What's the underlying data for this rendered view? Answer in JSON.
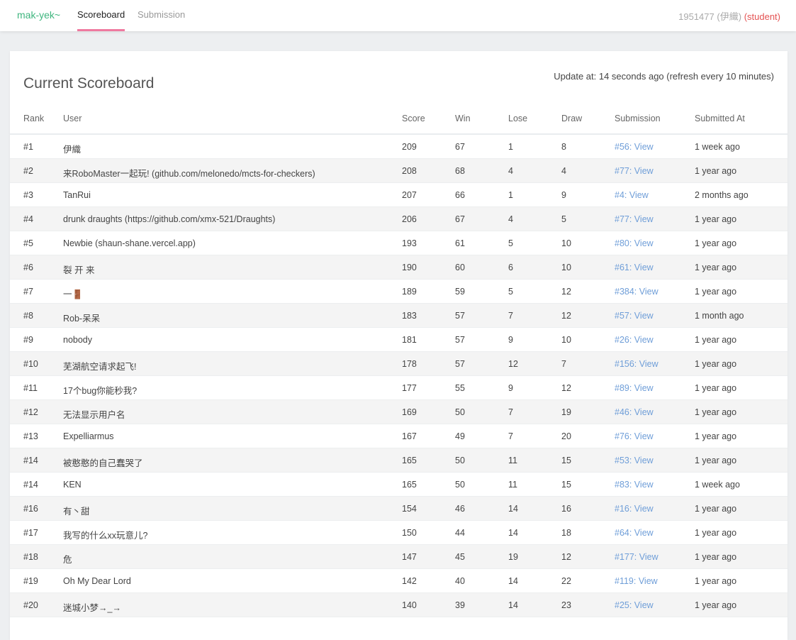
{
  "nav": {
    "brand": "mak-yek~",
    "tabs": [
      {
        "label": "Scoreboard",
        "active": true
      },
      {
        "label": "Submission",
        "active": false
      }
    ],
    "user_id": "1951477",
    "user_name": "(伊織)",
    "user_role": "(student)"
  },
  "scoreboard": {
    "title": "Current Scoreboard",
    "update_text": "Update at: 14 seconds ago (refresh every 10 minutes)",
    "columns": [
      "Rank",
      "User",
      "Score",
      "Win",
      "Lose",
      "Draw",
      "Submission",
      "Submitted At"
    ],
    "rows": [
      {
        "rank": "#1",
        "user": "伊織",
        "score": "209",
        "win": "67",
        "lose": "1",
        "draw": "8",
        "submission": "#56: View",
        "submitted_at": "1 week ago"
      },
      {
        "rank": "#2",
        "user": "来RoboMaster一起玩! (github.com/melonedo/mcts-for-checkers)",
        "score": "208",
        "win": "68",
        "lose": "4",
        "draw": "4",
        "submission": "#77: View",
        "submitted_at": "1 year ago"
      },
      {
        "rank": "#3",
        "user": "TanRui",
        "score": "207",
        "win": "66",
        "lose": "1",
        "draw": "9",
        "submission": "#4: View",
        "submitted_at": "2 months ago"
      },
      {
        "rank": "#4",
        "user": "drunk draughts (https://github.com/xmx-521/Draughts)",
        "score": "206",
        "win": "67",
        "lose": "4",
        "draw": "5",
        "submission": "#77: View",
        "submitted_at": "1 year ago"
      },
      {
        "rank": "#5",
        "user": "Newbie (shaun-shane.vercel.app)",
        "score": "193",
        "win": "61",
        "lose": "5",
        "draw": "10",
        "submission": "#80: View",
        "submitted_at": "1 year ago"
      },
      {
        "rank": "#6",
        "user": "裂 开 来",
        "score": "190",
        "win": "60",
        "lose": "6",
        "draw": "10",
        "submission": "#61: View",
        "submitted_at": "1 year ago"
      },
      {
        "rank": "#7",
        "user": "一🚪",
        "score": "189",
        "win": "59",
        "lose": "5",
        "draw": "12",
        "submission": "#384: View",
        "submitted_at": "1 year ago"
      },
      {
        "rank": "#8",
        "user": "Rob-呆呆",
        "score": "183",
        "win": "57",
        "lose": "7",
        "draw": "12",
        "submission": "#57: View",
        "submitted_at": "1 month ago"
      },
      {
        "rank": "#9",
        "user": "nobody",
        "score": "181",
        "win": "57",
        "lose": "9",
        "draw": "10",
        "submission": "#26: View",
        "submitted_at": "1 year ago"
      },
      {
        "rank": "#10",
        "user": "芜湖航空请求起飞!",
        "score": "178",
        "win": "57",
        "lose": "12",
        "draw": "7",
        "submission": "#156: View",
        "submitted_at": "1 year ago"
      },
      {
        "rank": "#11",
        "user": "17个bug你能秒我?",
        "score": "177",
        "win": "55",
        "lose": "9",
        "draw": "12",
        "submission": "#89: View",
        "submitted_at": "1 year ago"
      },
      {
        "rank": "#12",
        "user": "无法显示用户名",
        "score": "169",
        "win": "50",
        "lose": "7",
        "draw": "19",
        "submission": "#46: View",
        "submitted_at": "1 year ago"
      },
      {
        "rank": "#13",
        "user": "Expelliarmus",
        "score": "167",
        "win": "49",
        "lose": "7",
        "draw": "20",
        "submission": "#76: View",
        "submitted_at": "1 year ago"
      },
      {
        "rank": "#14",
        "user": "被憨憨的自己蠢哭了",
        "score": "165",
        "win": "50",
        "lose": "11",
        "draw": "15",
        "submission": "#53: View",
        "submitted_at": "1 year ago"
      },
      {
        "rank": "#14",
        "user": "KEN",
        "score": "165",
        "win": "50",
        "lose": "11",
        "draw": "15",
        "submission": "#83: View",
        "submitted_at": "1 week ago"
      },
      {
        "rank": "#16",
        "user": "有丶甜",
        "score": "154",
        "win": "46",
        "lose": "14",
        "draw": "16",
        "submission": "#16: View",
        "submitted_at": "1 year ago"
      },
      {
        "rank": "#17",
        "user": "我写的什么xx玩意儿?",
        "score": "150",
        "win": "44",
        "lose": "14",
        "draw": "18",
        "submission": "#64: View",
        "submitted_at": "1 year ago"
      },
      {
        "rank": "#18",
        "user": "危",
        "score": "147",
        "win": "45",
        "lose": "19",
        "draw": "12",
        "submission": "#177: View",
        "submitted_at": "1 year ago"
      },
      {
        "rank": "#19",
        "user": "Oh My Dear Lord",
        "score": "142",
        "win": "40",
        "lose": "14",
        "draw": "22",
        "submission": "#119: View",
        "submitted_at": "1 year ago"
      },
      {
        "rank": "#20",
        "user": "迷城小梦→_→",
        "score": "140",
        "win": "39",
        "lose": "14",
        "draw": "23",
        "submission": "#25: View",
        "submitted_at": "1 year ago"
      }
    ]
  }
}
